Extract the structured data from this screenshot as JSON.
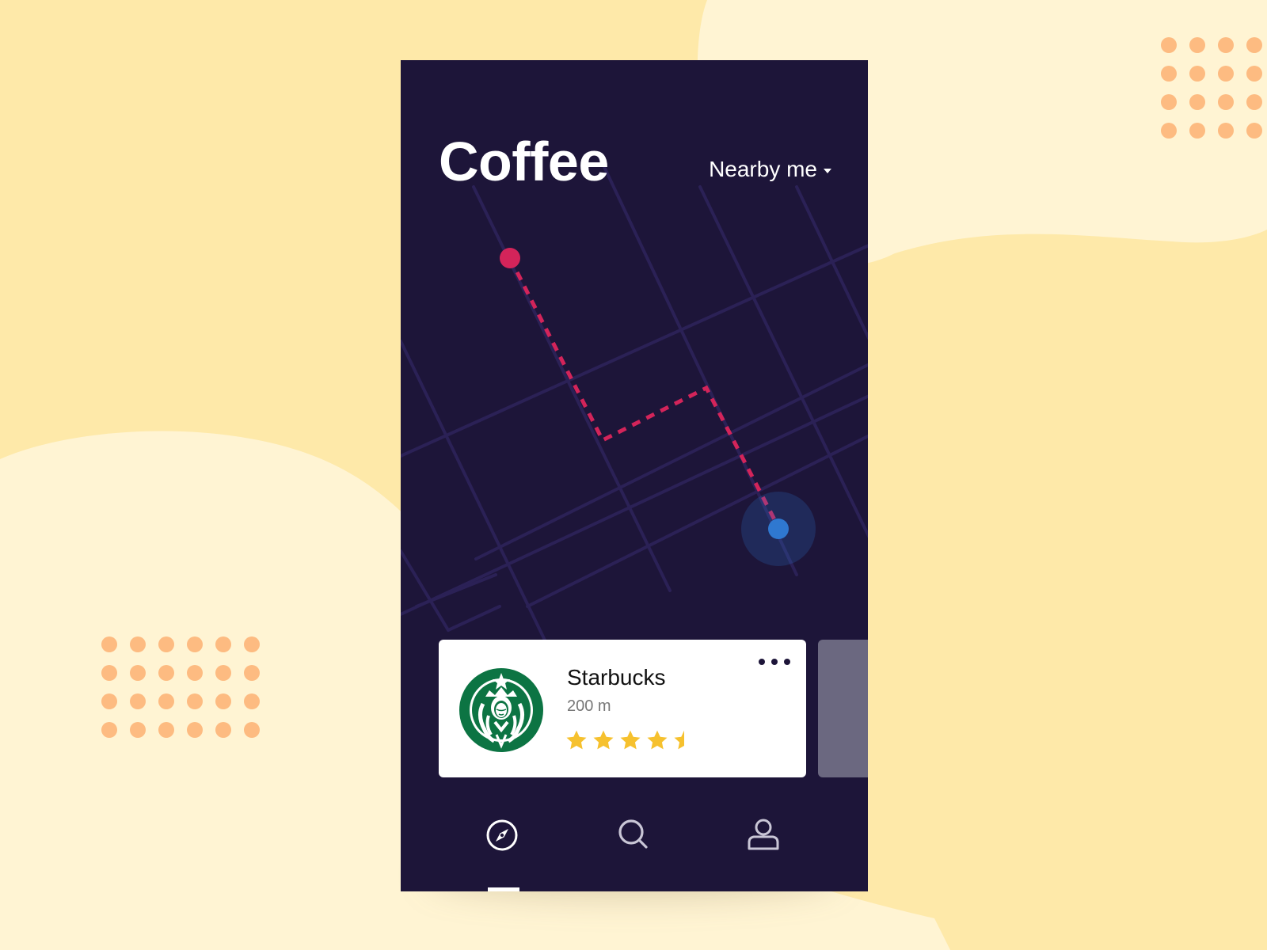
{
  "theme": {
    "page_background": "#fee9a9",
    "blob_color": "#fff4d3",
    "dot_color": "#fdbb81",
    "phone_background": "#1d1539",
    "map_street_color": "#2b2156",
    "route_color": "#d3245a",
    "user_location_color": "#2f78d0",
    "star_color": "#f6c12e",
    "card_peek_color": "#6b6880"
  },
  "header": {
    "title": "Coffee",
    "filter_label": "Nearby me",
    "filter_icon": "caret-down-icon"
  },
  "map": {
    "destination_pin": "destination-pin",
    "user_location": "user-location-dot"
  },
  "cards": [
    {
      "name": "Starbucks",
      "distance": "200 m",
      "rating": 4.5,
      "rating_max": 5,
      "logo": "starbucks-logo",
      "menu_icon": "more-horizontal-icon"
    }
  ],
  "bottom_nav": {
    "items": [
      {
        "icon": "compass-icon",
        "active": true
      },
      {
        "icon": "search-icon",
        "active": false
      },
      {
        "icon": "user-icon",
        "active": false
      }
    ]
  }
}
